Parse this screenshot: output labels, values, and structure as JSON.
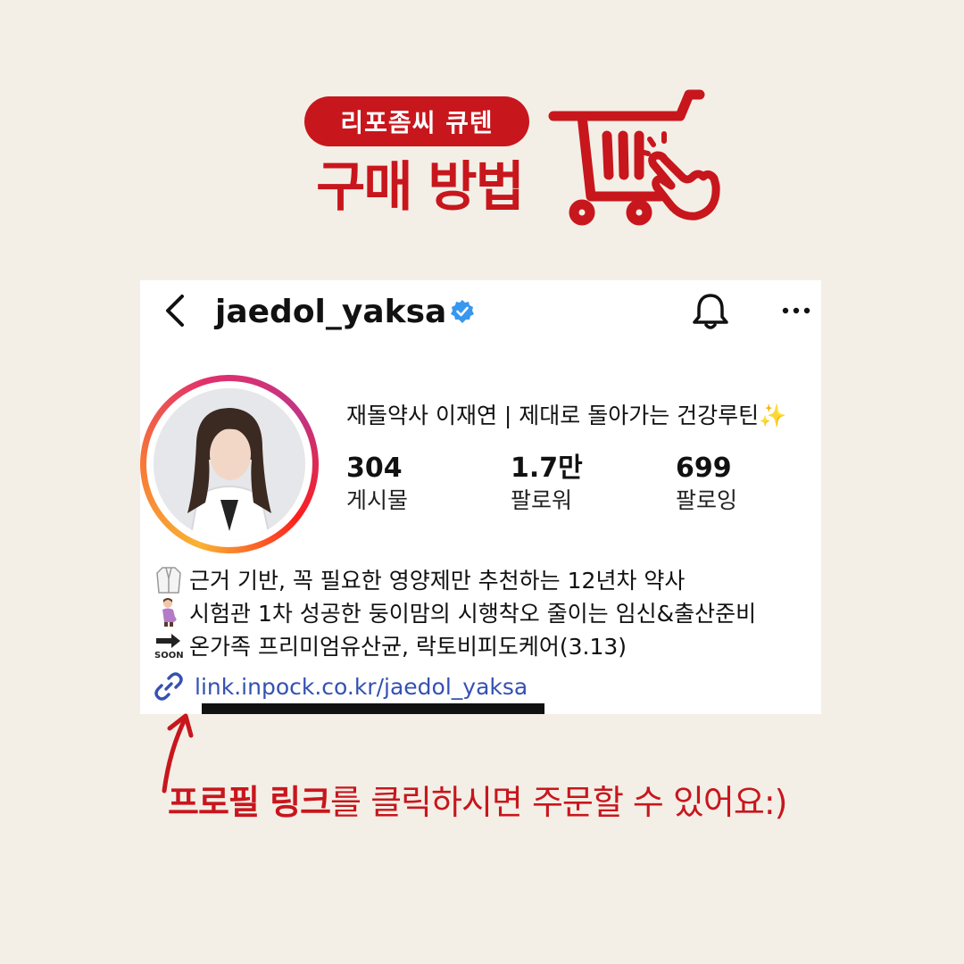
{
  "banner": {
    "pill_text": "리포좀씨 큐텐",
    "headline": "구매 방법"
  },
  "profile": {
    "username": "jaedol_yaksa",
    "display_name": "재돌약사 이재연 | 제대로 돌아가는 건강루틴✨",
    "stats": [
      {
        "value": "304",
        "label": "게시물"
      },
      {
        "value": "1.7만",
        "label": "팔로워"
      },
      {
        "value": "699",
        "label": "팔로잉"
      }
    ],
    "bio": [
      {
        "icon": "lab-coat-icon",
        "text": "근거 기반, 꼭 필요한 영양제만 추천하는 12년차 약사"
      },
      {
        "icon": "pregnant-woman-icon",
        "text": "시험관 1차 성공한 둥이맘의 시행착오 줄이는 임신&출산준비"
      },
      {
        "icon": "soon-arrow-icon",
        "text": " 온가족 프리미엄유산균, 락토비피도케어(3.13)"
      }
    ],
    "link": "link.inpock.co.kr/jaedol_yaksa"
  },
  "cta": {
    "bold_text": "프로필 링크",
    "rest_text": "를 클릭하시면 주문할 수 있어요:)"
  },
  "colors": {
    "accent": "#c8161d",
    "background": "#f3efe6",
    "link": "#3451b2",
    "verified": "#3897f0"
  }
}
